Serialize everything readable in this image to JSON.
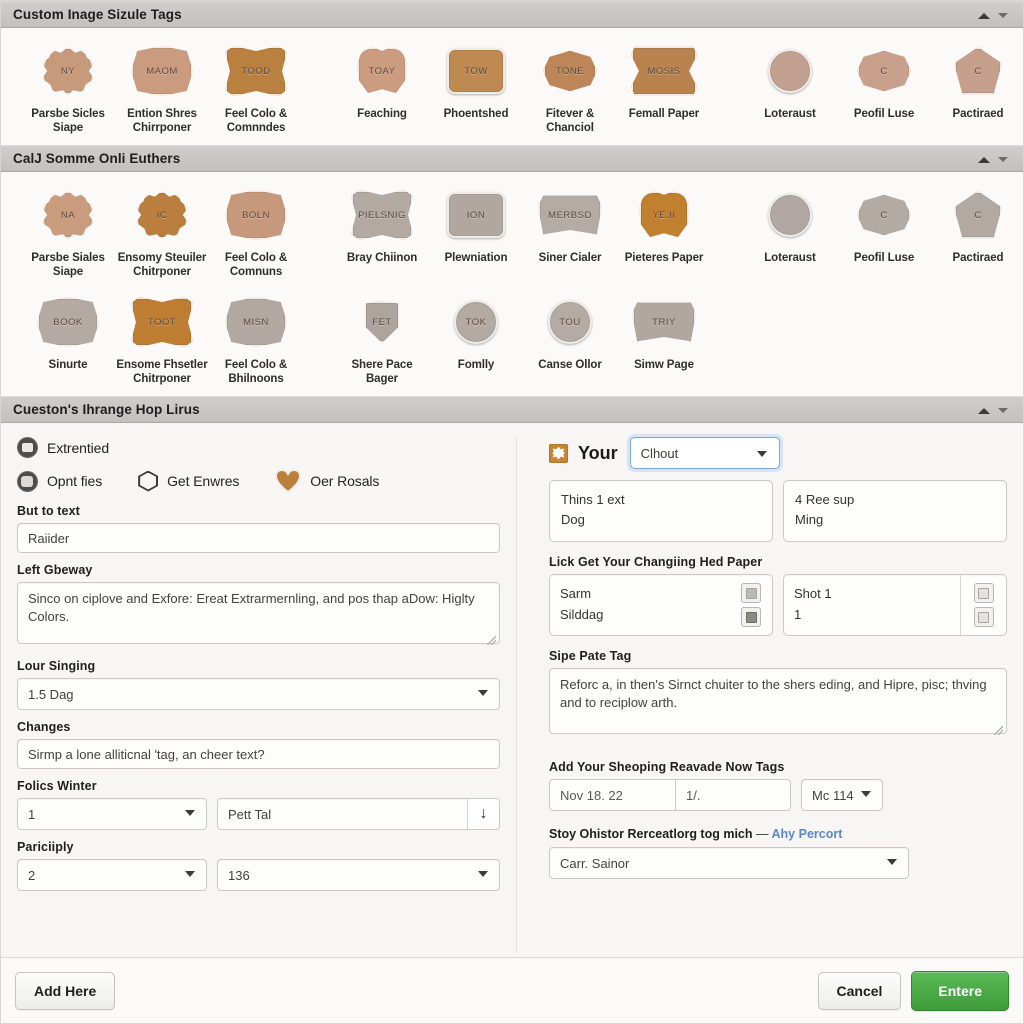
{
  "sections": [
    {
      "title": "Custom Inage Sizule Tags",
      "collapse_up_icon": "chevron-up-icon",
      "collapse_down_icon": "chevron-down-icon"
    },
    {
      "title": "CalJ Somme Onli Euthers"
    },
    {
      "title": "Cueston's Ihrange Hop Lirus"
    }
  ],
  "gallery_1": [
    {
      "glyph": "NY",
      "shape": "s-flower",
      "color": "#c89a7c",
      "label": "Parsbe Sicles Siape"
    },
    {
      "glyph": "MAOM",
      "shape": "s-plaque",
      "color": "#cb9b7f",
      "label": "Ention Shres Chirrponer"
    },
    {
      "glyph": "TOOD",
      "shape": "s-wavy",
      "color": "#b9803f",
      "label": "Feel Colo & Comnndes"
    },
    {
      "glyph": "TOAY",
      "shape": "s-apple",
      "color": "#cb9c80",
      "label": "Feaching"
    },
    {
      "glyph": "TOW",
      "shape": "s-round-rect",
      "color": "#be8a52",
      "label": "Phoentshed"
    },
    {
      "glyph": "TONE",
      "shape": "s-bow",
      "color": "#bd8658",
      "label": "Fitever & Chanciol"
    },
    {
      "glyph": "MOSIS",
      "shape": "s-ornate",
      "color": "#b8834f",
      "label": "Femall Paper"
    },
    {
      "glyph": "",
      "shape": "s-circle",
      "color": "#c2a191",
      "label": "Loteraust"
    },
    {
      "glyph": "C",
      "shape": "s-bow",
      "color": "#c8a08c",
      "label": "Peofil Luse"
    },
    {
      "glyph": "C",
      "shape": "s-pent",
      "color": "#c59e8c",
      "label": "Pactiraed"
    }
  ],
  "gallery_2_row1": [
    {
      "glyph": "NA",
      "shape": "s-flower",
      "color": "#c99c7e",
      "label": "Parsbe Siales Siape"
    },
    {
      "glyph": "IC",
      "shape": "s-flower",
      "color": "#ba7f3f",
      "label": "Ensomy Steuiler Chitrponer"
    },
    {
      "glyph": "BOLN",
      "shape": "s-plaque",
      "color": "#c6987c",
      "label": "Feel Colo & Comnuns"
    },
    {
      "glyph": "PIELSNIG",
      "shape": "s-wavy",
      "color": "#b3a9a3",
      "label": "Bray Chiinon"
    },
    {
      "glyph": "ION",
      "shape": "s-round-rect",
      "color": "#b0a7a1",
      "label": "Plewniation"
    },
    {
      "glyph": "MERBSD",
      "shape": "s-badge",
      "color": "#b5aba5",
      "label": "Siner Cialer"
    },
    {
      "glyph": "YE.II",
      "shape": "s-apple",
      "color": "#c1802f",
      "label": "Pieteres Paper"
    },
    {
      "glyph": "",
      "shape": "s-circle",
      "color": "#b1a8a3",
      "label": "Loteraust"
    },
    {
      "glyph": "C",
      "shape": "s-bow",
      "color": "#b3aaa4",
      "label": "Peofil Luse"
    },
    {
      "glyph": "C",
      "shape": "s-pent",
      "color": "#b2a9a3",
      "label": "Pactiraed"
    }
  ],
  "gallery_2_row2": [
    {
      "glyph": "BOOK",
      "shape": "s-plaque",
      "color": "#b4aaa3",
      "label": "Sinurte"
    },
    {
      "glyph": "TOOT",
      "shape": "s-wavy",
      "color": "#bd7d33",
      "label": "Ensome Fhsetler Chitrponer"
    },
    {
      "glyph": "MISN",
      "shape": "s-plaque",
      "color": "#b2a8a1",
      "label": "Feel Colo & Bhilnoons"
    },
    {
      "glyph": "FET",
      "shape": "s-shield",
      "color": "#ada49e",
      "label": "Shere Pace Bager"
    },
    {
      "glyph": "TOK",
      "shape": "s-circle",
      "color": "#b3aaa4",
      "label": "Fomlly"
    },
    {
      "glyph": "TOU",
      "shape": "s-circle",
      "color": "#b4aba5",
      "label": "Canse Ollor"
    },
    {
      "glyph": "TRIY",
      "shape": "s-badge",
      "color": "#b0a7a0",
      "label": "Simw Page"
    }
  ],
  "form": {
    "chips_row1": [
      {
        "icon": "image-badge-icon",
        "label": "Extrentied"
      }
    ],
    "chips_row2": [
      {
        "icon": "image-badge-icon",
        "label": "Opnt fies"
      },
      {
        "icon": "hexagon-icon",
        "label": "Get Enwres"
      },
      {
        "icon": "heart-icon",
        "label": "Oer Rosals"
      }
    ],
    "but_to_text_label": "But to text",
    "but_to_text_value": "Raiider",
    "left_gbeway_label": "Left Gbeway",
    "left_gbeway_value": "Sinco on ciplove and Exfore: Ereat Extrarmernling, and pos thap aDow: Higlty Colors.",
    "lour_singing_label": "Lour Singing",
    "lour_singing_value": "1.5 Dag",
    "changes_label": "Changes",
    "changes_value": "Sirmp a lone alliticnal 'tag, an cheer text?",
    "folics_winter_label": "Folics Winter",
    "folics_winter_select": "1",
    "folics_winter_text": "Pett Tal",
    "folics_winter_stepper_icon": "arrow-down-icon",
    "pariciiply_label": "Pariciiply",
    "pariciiply_select_a": "2",
    "pariciiply_select_b": "136"
  },
  "right": {
    "badge_icon": "orange-burst-icon",
    "your_text": "Your",
    "your_select_value": "Clhout",
    "cards": [
      {
        "l1": "Thins 1 ext",
        "l2": "Dog"
      },
      {
        "l1": "4 Ree sup",
        "l2": "Ming"
      }
    ],
    "lick_label": "Lick Get Your Changiing Hed Paper",
    "split_cards": [
      {
        "l1": "Sarm",
        "l2": "Silddag",
        "icon1": "note-icon",
        "icon2": "note-filled-icon"
      },
      {
        "l1": "Shot 1",
        "l2": "1",
        "icon1": "checkbox-icon",
        "icon2": "checkbox-icon"
      }
    ],
    "sipe_label": "Sipe Pate Tag",
    "sipe_value": "Reforc a, in then's Sirnct chuiter to the shers eding, and Hipre, pisc; thving and to reciplow arth.",
    "add_label": "Add Your Sheoping Reavade Now Tags",
    "date_value": "Nov 18. 22",
    "date_qty": "1/.",
    "date_select": "Mc 114",
    "stoy_label": "Stoy Ohistor Rerceatlorg tog mich",
    "stoy_dash": "—",
    "stoy_link": "Ahy Percort",
    "carr_select": "Carr. Sainor"
  },
  "footer": {
    "add_here": "Add Here",
    "cancel": "Cancel",
    "enter": "Entere",
    "green": "#44a33e"
  }
}
